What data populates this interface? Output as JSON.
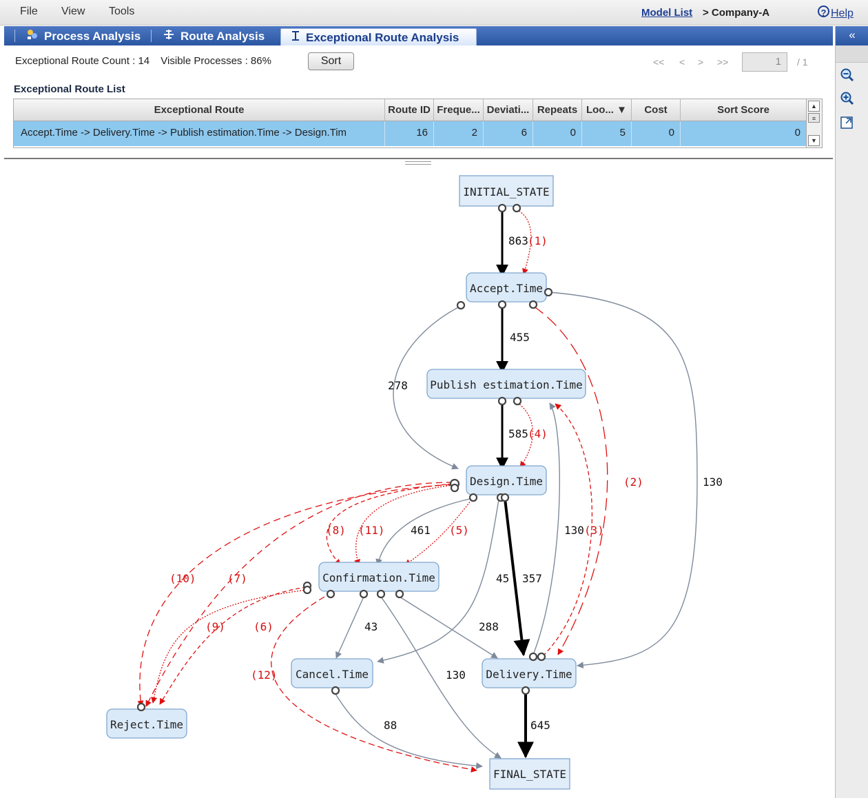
{
  "menu": {
    "file": "File",
    "view": "View",
    "tools": "Tools"
  },
  "header": {
    "model_list": "Model List",
    "company": "> Company-A",
    "help": "Help",
    "help_glyph": "?"
  },
  "tabs": {
    "process": "Process Analysis",
    "route": "Route Analysis",
    "exceptional": "Exceptional Route Analysis"
  },
  "side": {
    "collapse": "«"
  },
  "summary": {
    "count_text": "Exceptional Route Count : 14",
    "visible_text": "Visible Processes : 86%",
    "sort_label": "Sort"
  },
  "pager": {
    "first": "<<",
    "prev": "<",
    "next": ">",
    "last": ">>",
    "page": "1",
    "of": "/ 1"
  },
  "list": {
    "title": "Exceptional Route List",
    "columns": [
      "Exceptional Route",
      "Route ID",
      "Freque...",
      "Deviati...",
      "Repeats",
      "Loo... ▼",
      "Cost",
      "Sort Score"
    ],
    "rows": [
      {
        "route": "Accept.Time -> Delivery.Time -> Publish estimation.Time -> Design.Tim",
        "route_id": "16",
        "frequency": "2",
        "deviation": "6",
        "repeats": "0",
        "loops": "5",
        "cost": "0",
        "sort_score": "0"
      }
    ]
  },
  "graph": {
    "nodes": {
      "initial": "INITIAL_STATE",
      "accept": "Accept.Time",
      "publish": "Publish estimation.Time",
      "design": "Design.Time",
      "confirmation": "Confirmation.Time",
      "cancel": "Cancel.Time",
      "delivery": "Delivery.Time",
      "reject": "Reject.Time",
      "final": "FINAL_STATE"
    },
    "edge_counts": {
      "initial_accept": "863",
      "accept_publish": "455",
      "accept_design": "278",
      "accept_delivery": "130",
      "publish_design": "585",
      "design_confirmation": "461",
      "design_cancel": "45",
      "design_delivery": "357",
      "delivery_publish": "130",
      "confirmation_cancel": "43",
      "confirmation_delivery": "288",
      "confirmation_final": "130",
      "cancel_final": "88",
      "delivery_final": "645"
    },
    "route_steps": [
      "(1)",
      "(2)",
      "(3)",
      "(4)",
      "(5)",
      "(6)",
      "(7)",
      "(8)",
      "(9)",
      "(10)",
      "(11)",
      "(12)"
    ],
    "colors": {
      "node_fill": "#dbeaf8",
      "route_red": "#e01010",
      "edge_gray": "#7e8a9a",
      "main_edge": "#000000"
    }
  }
}
